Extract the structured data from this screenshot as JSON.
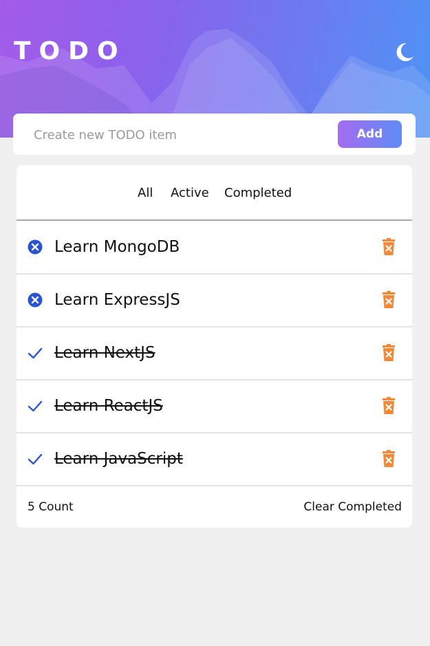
{
  "header": {
    "title": "TODO",
    "theme_icon": "moon-icon"
  },
  "new_todo": {
    "placeholder": "Create new TODO item",
    "value": "",
    "add_label": "Add"
  },
  "filters": {
    "all": "All",
    "active": "Active",
    "completed": "Completed"
  },
  "todos": [
    {
      "text": "Learn MongoDB",
      "completed": false,
      "status_icon": "circle-x-icon",
      "delete_icon": "trash-icon"
    },
    {
      "text": "Learn ExpressJS",
      "completed": false,
      "status_icon": "circle-x-icon",
      "delete_icon": "trash-icon"
    },
    {
      "text": "Learn NextJS",
      "completed": true,
      "status_icon": "check-icon",
      "delete_icon": "trash-icon"
    },
    {
      "text": "Learn ReactJS",
      "completed": true,
      "status_icon": "check-icon",
      "delete_icon": "trash-icon"
    },
    {
      "text": "Learn JavaScript",
      "completed": true,
      "status_icon": "check-icon",
      "delete_icon": "trash-icon"
    }
  ],
  "footer": {
    "count": "5 Count",
    "clear_label": "Clear Completed"
  },
  "colors": {
    "accent_blue": "#2a55d0",
    "trash_orange": "#f08a3a",
    "gradient_start": "#a35be9",
    "gradient_end": "#4f93f5"
  }
}
